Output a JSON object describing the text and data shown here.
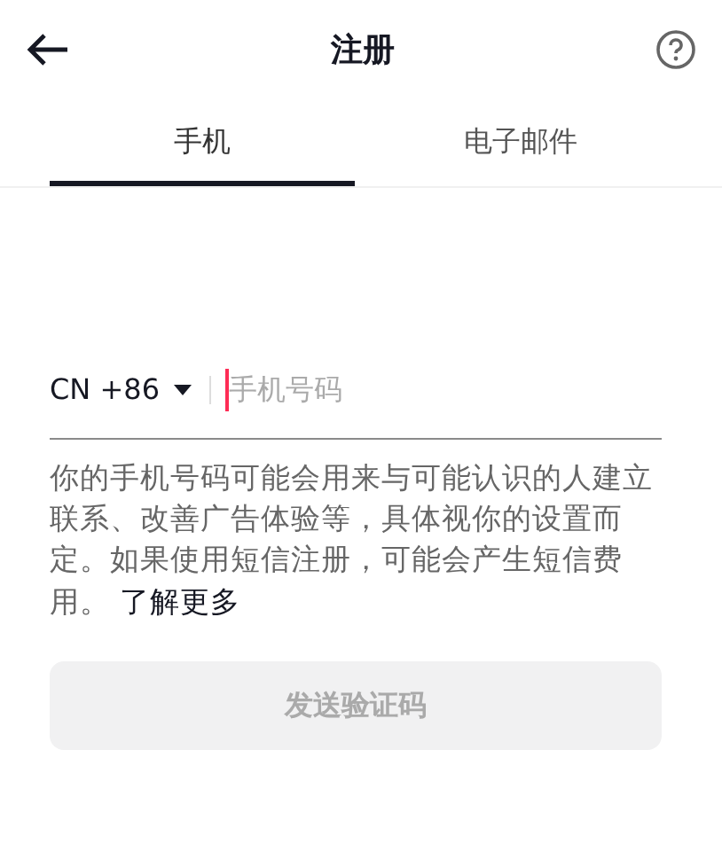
{
  "header": {
    "title": "注册"
  },
  "tabs": [
    {
      "label": "手机",
      "selected": true
    },
    {
      "label": "电子邮件",
      "selected": false
    }
  ],
  "phone": {
    "country_code": "CN +86",
    "placeholder": "手机号码"
  },
  "notice": {
    "text": "你的手机号码可能会用来与可能认识的人建立联系、改善广告体验等，具体视你的设置而定。如果使用短信注册，可能会产生短信费用。",
    "link": "了解更多"
  },
  "send_button": {
    "label": "发送验证码",
    "disabled": true
  }
}
